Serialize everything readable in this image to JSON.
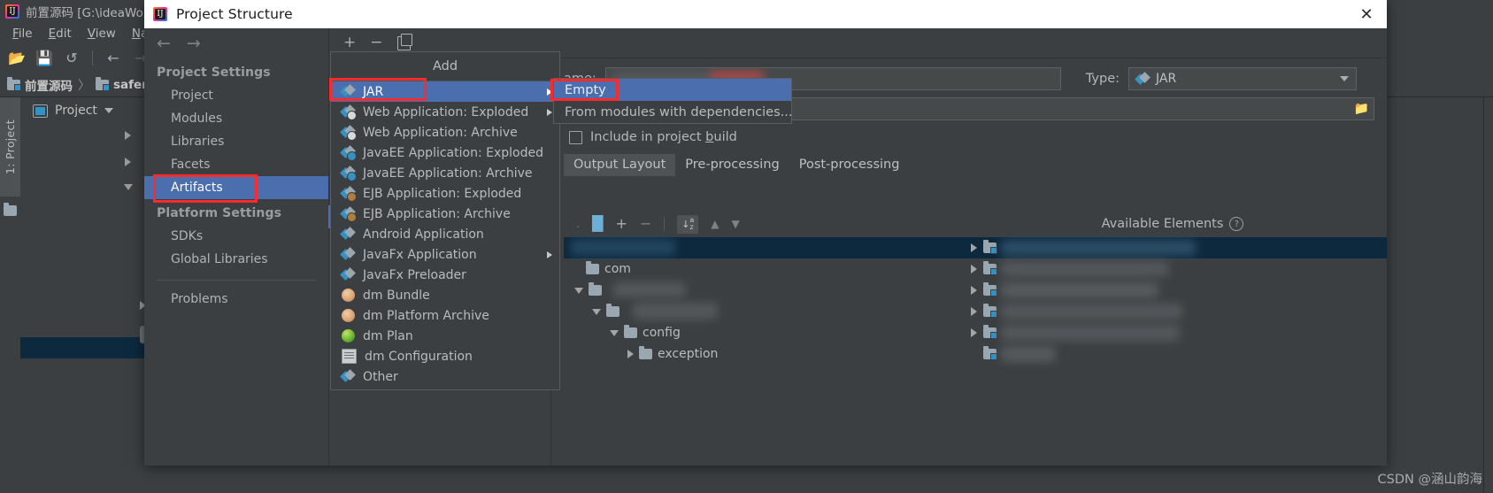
{
  "ide": {
    "window_title": "前置源码 [G:\\ideaWor",
    "logo_icon": "intellij-idea-logo",
    "menus": [
      "File",
      "Edit",
      "View",
      "Navig"
    ],
    "toolbar_icons": [
      "open-folder-icon",
      "save-icon",
      "sync-icon",
      "back-arrow-icon",
      "forward-arrow-icon"
    ],
    "breadcrumb": [
      "前置源码",
      "safem"
    ],
    "breadcrumb_separator": "〉",
    "tool_window_tab": "1: Project",
    "project_panel_label": "Project",
    "project_panel_icon": "project-view-icon"
  },
  "dialog": {
    "title": "Project Structure",
    "title_icon": "intellij-idea-logo",
    "close_icon": "✕",
    "nav": {
      "back_icon": "←",
      "forward_icon": "→",
      "groups": [
        {
          "title": "Project Settings",
          "items": [
            {
              "label": "Project",
              "selected": false
            },
            {
              "label": "Modules",
              "selected": false
            },
            {
              "label": "Libraries",
              "selected": false
            },
            {
              "label": "Facets",
              "selected": false
            },
            {
              "label": "Artifacts",
              "selected": true
            }
          ]
        },
        {
          "title": "Platform Settings",
          "items": [
            {
              "label": "SDKs",
              "selected": false
            },
            {
              "label": "Global Libraries",
              "selected": false
            }
          ]
        }
      ],
      "extra_items": [
        {
          "label": "Problems",
          "selected": false
        }
      ]
    },
    "artifact_toolbar": {
      "add_icon": "+",
      "remove_icon": "−",
      "copy_icon": "copy-icon"
    },
    "detail": {
      "name_label": "ame:",
      "name_value": "",
      "type_label": "Type:",
      "type_value": "JAR",
      "type_icon": "jar-artifact-icon",
      "output_directory_value": "",
      "browse_icon": "🗀",
      "include_in_build_label": "Include in project build",
      "include_in_build_label_pre": "Include in project ",
      "include_in_build_label_underlined": "b",
      "include_in_build_label_post": "uild",
      "include_in_build_checked": false,
      "tabs": [
        {
          "label": "Output Layout",
          "active": true
        },
        {
          "label": "Pre-processing",
          "active": false
        },
        {
          "label": "Post-processing",
          "active": false
        }
      ],
      "layout_toolbar": {
        "jar_icon": "create-archive-icon",
        "add_icon": "+",
        "remove_icon": "−",
        "sort_icon": "sort-alphabetically-icon",
        "up_icon": "▲",
        "down_icon": "▼"
      },
      "output_tree": [
        {
          "label": "",
          "indent": 0,
          "arrow": "none",
          "redacted": true,
          "selected": true
        },
        {
          "label": "com",
          "indent": 1,
          "arrow": "none",
          "redacted": false,
          "selected": false
        },
        {
          "label": "",
          "indent": 1,
          "arrow": "down",
          "redacted": true,
          "selected": false
        },
        {
          "label": "",
          "indent": 2,
          "arrow": "down",
          "redacted": true,
          "selected": false
        },
        {
          "label": "config",
          "indent": 3,
          "arrow": "down",
          "redacted": false,
          "selected": false
        },
        {
          "label": "exception",
          "indent": 4,
          "arrow": "right",
          "redacted": false,
          "selected": false
        }
      ],
      "available_elements_title": "Available Elements",
      "available_elements_help_icon": "?",
      "available_elements": [
        {
          "label": "",
          "redacted": true,
          "selected": true
        },
        {
          "label": "",
          "redacted": true,
          "selected": false
        },
        {
          "label": "",
          "redacted": true,
          "selected": false
        },
        {
          "label": "",
          "redacted": true,
          "selected": false
        },
        {
          "label": "",
          "redacted": true,
          "selected": false
        },
        {
          "label": "",
          "redacted": true,
          "selected": false
        }
      ]
    }
  },
  "add_menu": {
    "title": "Add",
    "items": [
      {
        "label": "JAR",
        "icon": "jar-artifact-icon",
        "submenu": true,
        "selected": true
      },
      {
        "label": "Web Application: Exploded",
        "icon": "web-exploded-icon",
        "submenu": true,
        "selected": false
      },
      {
        "label": "Web Application: Archive",
        "icon": "web-archive-icon",
        "submenu": false,
        "selected": false
      },
      {
        "label": "JavaEE Application: Exploded",
        "icon": "javaee-exploded-icon",
        "submenu": false,
        "selected": false
      },
      {
        "label": "JavaEE Application: Archive",
        "icon": "javaee-archive-icon",
        "submenu": false,
        "selected": false
      },
      {
        "label": "EJB Application: Exploded",
        "icon": "ejb-exploded-icon",
        "submenu": false,
        "selected": false
      },
      {
        "label": "EJB Application: Archive",
        "icon": "ejb-archive-icon",
        "submenu": false,
        "selected": false
      },
      {
        "label": "Android Application",
        "icon": "android-artifact-icon",
        "submenu": false,
        "selected": false
      },
      {
        "label": "JavaFx Application",
        "icon": "javafx-artifact-icon",
        "submenu": true,
        "selected": false
      },
      {
        "label": "JavaFx Preloader",
        "icon": "javafx-preloader-icon",
        "submenu": false,
        "selected": false
      },
      {
        "label": "dm Bundle",
        "icon": "dm-bundle-icon",
        "submenu": false,
        "selected": false
      },
      {
        "label": "dm Platform Archive",
        "icon": "dm-platform-archive-icon",
        "submenu": false,
        "selected": false
      },
      {
        "label": "dm Plan",
        "icon": "dm-plan-icon",
        "submenu": false,
        "selected": false
      },
      {
        "label": "dm Configuration",
        "icon": "dm-configuration-icon",
        "submenu": false,
        "selected": false
      },
      {
        "label": "Other",
        "icon": "other-artifact-icon",
        "submenu": false,
        "selected": false
      }
    ]
  },
  "sub_menu": {
    "items": [
      {
        "label": "Empty",
        "selected": true
      },
      {
        "label": "From modules with dependencies...",
        "selected": false
      }
    ]
  },
  "highlights": {
    "accent_color": "#fc2b2b",
    "targets": [
      "artifacts-nav-item",
      "jar-menu-item",
      "empty-submenu-item"
    ]
  },
  "watermark": {
    "text": "CSDN @涵山韵海"
  }
}
